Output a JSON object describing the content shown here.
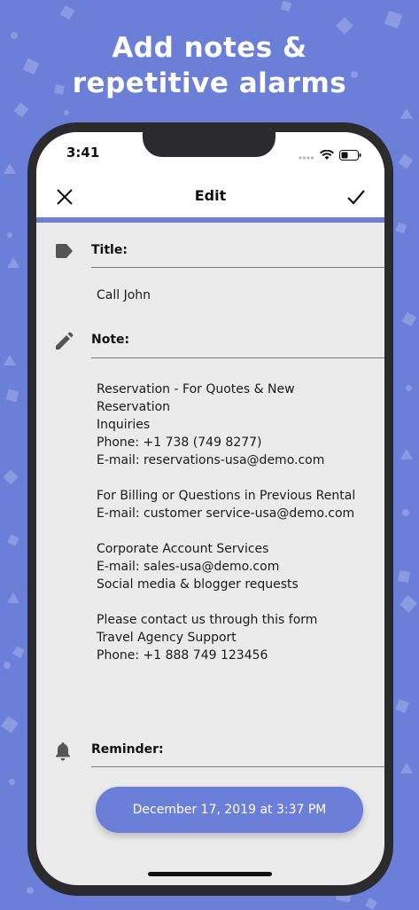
{
  "headline": {
    "line1": "Add notes &",
    "line2": "repetitive alarms"
  },
  "status_bar": {
    "time": "3:41"
  },
  "nav": {
    "title": "Edit",
    "close_icon": "close-icon",
    "confirm_icon": "checkmark-icon"
  },
  "title_section": {
    "label": "Title:",
    "value": "Call John",
    "icon": "tag-icon"
  },
  "note_section": {
    "label": "Note:",
    "icon": "pencil-icon",
    "paragraphs": [
      [
        "Reservation - For Quotes & New Reservation",
        "Inquiries",
        "Phone: +1 738 (749 8277)",
        "E-mail: reservations-usa@demo.com"
      ],
      [
        "For Billing or Questions in Previous Rental",
        "E-mail: customer service-usa@demo.com"
      ],
      [
        "Corporate Account Services",
        "E-mail: sales-usa@demo.com",
        "Social media & blogger requests"
      ],
      [
        "Please contact us through this form",
        "Travel Agency Support",
        "Phone: +1 888 749 123456"
      ]
    ]
  },
  "reminder_section": {
    "label": "Reminder:",
    "icon": "bell-icon",
    "button_label": "December 17, 2019 at 3:37 PM"
  },
  "colors": {
    "accent": "#6b7fd8",
    "screen_bg": "#ebebeb",
    "phone_frame": "#2b2b2e"
  }
}
